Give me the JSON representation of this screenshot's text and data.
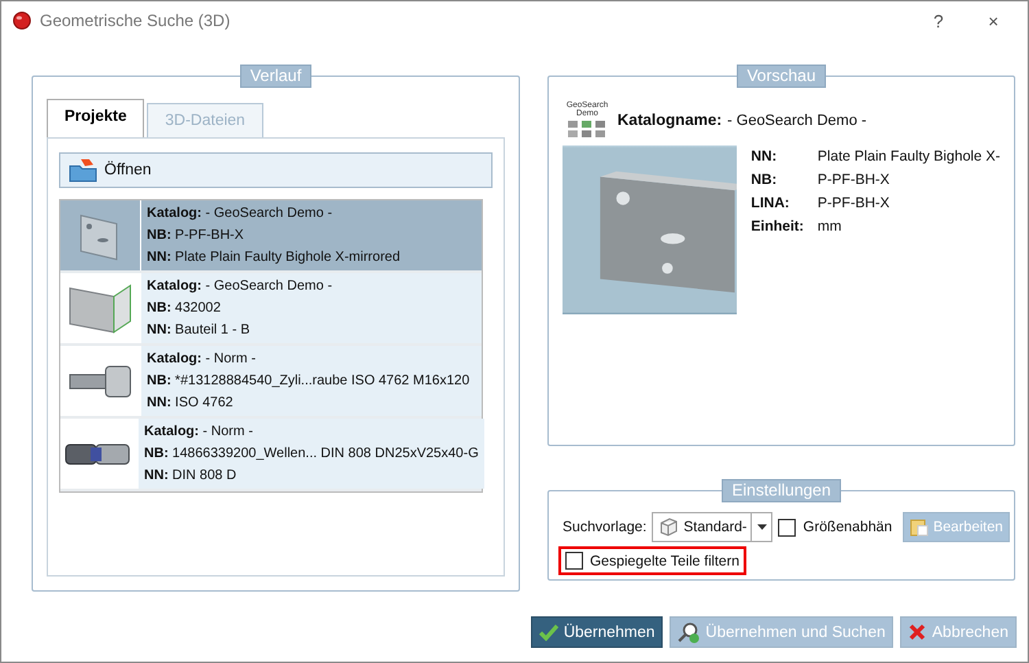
{
  "window": {
    "title": "Geometrische Suche (3D)",
    "help": "?",
    "close": "×"
  },
  "history": {
    "title": "Verlauf",
    "tabs": [
      {
        "label": "Projekte",
        "selected": true
      },
      {
        "label": "3D-Dateien",
        "selected": false
      }
    ],
    "open_button": "Öffnen",
    "items": [
      {
        "kind": "plate",
        "selected": true,
        "fields": [
          {
            "label": "Katalog:",
            "value": "- GeoSearch Demo -"
          },
          {
            "label": "NB:",
            "value": "P-PF-BH-X"
          },
          {
            "label": "NN:",
            "value": "Plate Plain Faulty Bighole X-mirrored"
          }
        ]
      },
      {
        "kind": "bracket",
        "selected": false,
        "fields": [
          {
            "label": "Katalog:",
            "value": "- GeoSearch Demo -"
          },
          {
            "label": "NB:",
            "value": "432002"
          },
          {
            "label": "NN:",
            "value": "Bauteil 1 - B"
          }
        ]
      },
      {
        "kind": "screw",
        "selected": false,
        "fields": [
          {
            "label": "Katalog:",
            "value": "- Norm -"
          },
          {
            "label": "NB:",
            "value": "*#13128884540_Zyli...raube ISO 4762 M16x120"
          },
          {
            "label": "NN:",
            "value": "ISO 4762"
          }
        ]
      },
      {
        "kind": "joint",
        "selected": false,
        "fields": [
          {
            "label": "Katalog:",
            "value": "- Norm -"
          },
          {
            "label": "NB:",
            "value": "14866339200_Wellen... DIN 808 DN25xV25x40-G"
          },
          {
            "label": "NN:",
            "value": "DIN 808 D"
          }
        ]
      }
    ]
  },
  "preview": {
    "title": "Vorschau",
    "logo_lines": [
      "GeoSearch",
      "Demo"
    ],
    "catalog_label": "Katalogname:",
    "catalog_value": "- GeoSearch Demo -",
    "properties": [
      {
        "label": "NN:",
        "value": "Plate Plain Faulty Bighole X-"
      },
      {
        "label": "NB:",
        "value": "P-PF-BH-X"
      },
      {
        "label": "LINA:",
        "value": "P-PF-BH-X"
      },
      {
        "label": "Einheit:",
        "value": "mm"
      }
    ]
  },
  "settings": {
    "title": "Einstellungen",
    "template_label": "Suchvorlage:",
    "template_value": "Standard-",
    "size_dependent": {
      "label": "Größenabhän",
      "checked": false
    },
    "edit_button": {
      "label": "Bearbeiten",
      "disabled": true
    },
    "mirrored_filter": {
      "label": "Gespiegelte Teile filtern",
      "checked": false,
      "highlighted": true
    }
  },
  "buttons": [
    {
      "kind": "primary",
      "label": "Übernehmen"
    },
    {
      "kind": "search",
      "label": "Übernehmen und Suchen"
    },
    {
      "kind": "cancel",
      "label": "Abbrechen"
    }
  ]
}
